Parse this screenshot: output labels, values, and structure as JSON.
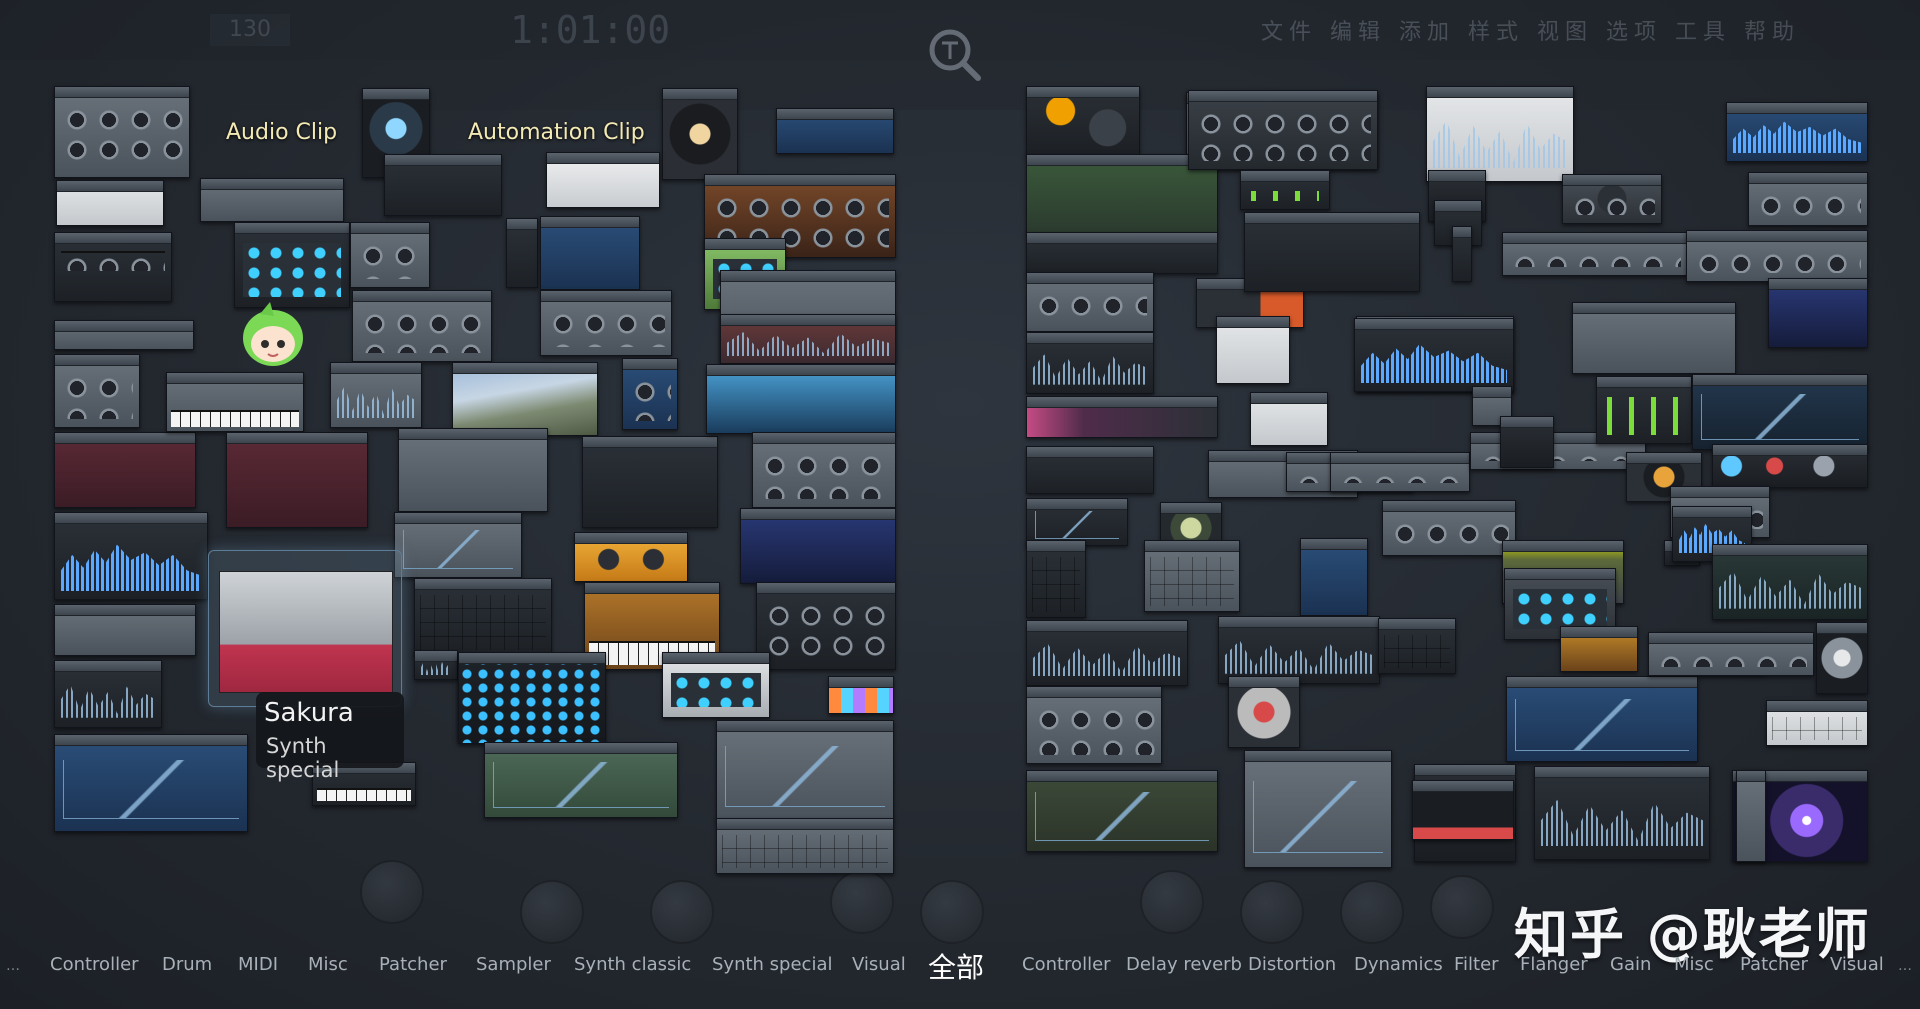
{
  "floating_labels": {
    "audio_clip": "Audio Clip",
    "automation_clip": "Automation Clip"
  },
  "hovered_plugin": {
    "name": "Sakura",
    "category": "Synth special"
  },
  "ghost_top": {
    "menu": "文件 编辑 添加 样式 视图 选项 工具 帮助",
    "bpm": "130",
    "time": "1:01:00"
  },
  "categories": {
    "generators": [
      "Controller",
      "Drum",
      "MIDI",
      "Misc",
      "Patcher",
      "Sampler",
      "Synth classic",
      "Synth special",
      "Visual"
    ],
    "all": "全部",
    "effects": [
      "Controller",
      "Delay reverb",
      "Distortion",
      "Dynamics",
      "Filter",
      "Flanger",
      "Gain",
      "Misc",
      "Patcher",
      "Visual"
    ]
  },
  "watermark": "知乎 @耿老师",
  "icons": {
    "search": "search-icon",
    "ellipsis": "ellipsis-icon"
  },
  "colors": {
    "accent_text": "#f3e9b4",
    "active_category": "#ffffff",
    "category": "#a8b0b8"
  }
}
